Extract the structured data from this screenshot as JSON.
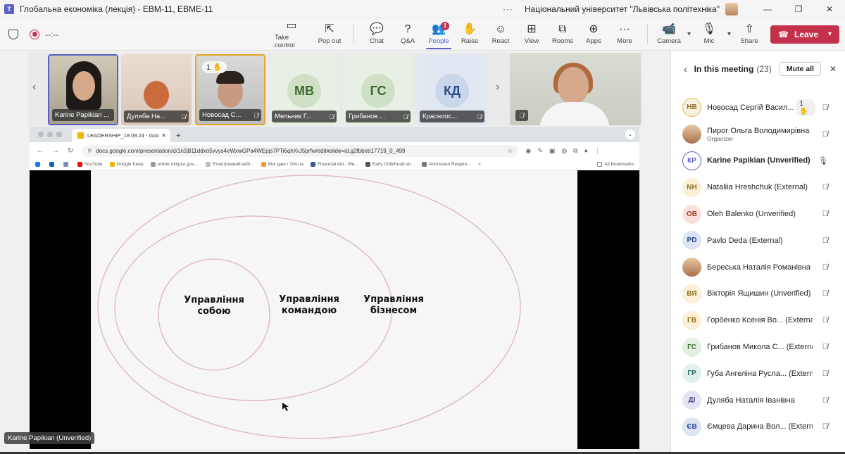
{
  "window": {
    "title": "Глобальна економіка (лекція) - ЕВМ-11, ЕВМЕ-11",
    "org": "Національний університет \"Львівська політехніка\"",
    "more": "···",
    "min": "—",
    "max": "❐",
    "close": "✕"
  },
  "toolbar": {
    "timer": "--:--",
    "buttons": [
      {
        "label": "Take control",
        "icon": "▭"
      },
      {
        "label": "Pop out",
        "icon": "⇱"
      },
      {
        "label": "Chat",
        "icon": "💬"
      },
      {
        "label": "Q&A",
        "icon": "?"
      },
      {
        "label": "People",
        "icon": "👥",
        "badge": "1"
      },
      {
        "label": "Raise",
        "icon": "✋"
      },
      {
        "label": "React",
        "icon": "☺"
      },
      {
        "label": "View",
        "icon": "⊞"
      },
      {
        "label": "Rooms",
        "icon": "⧉"
      },
      {
        "label": "Apps",
        "icon": "⊕"
      },
      {
        "label": "More",
        "icon": "···"
      },
      {
        "label": "Camera",
        "icon": "📹"
      },
      {
        "label": "Mic",
        "icon": "🎙"
      },
      {
        "label": "Share",
        "icon": "⇧"
      }
    ],
    "leave_label": "Leave"
  },
  "strip": {
    "tiles": [
      {
        "name": "Karine Papikian ...",
        "initials": ""
      },
      {
        "name": "Дуляба На...",
        "initials": ""
      },
      {
        "name": "Новосад С...",
        "initials": "",
        "hand": "1 ✋"
      },
      {
        "name": "Мельник Г...",
        "initials": "МВ"
      },
      {
        "name": "Грибанов ...",
        "initials": "ГС"
      },
      {
        "name": "Красноос...",
        "initials": "КД"
      }
    ]
  },
  "browser": {
    "tab_title": "LEADERSHIP_18.09.24 - Goo",
    "url": "docs.google.com/presentation/d/1nSB11ddxo5vvys4eWxwGPa4WEpjs7PTi6qhXrJ5prfw/edit#slide=id.g2fbbeb17719_0_499",
    "bookmarks": [
      "YouTube",
      "Google Keep",
      "online.minjust.gov....",
      "Електронний кабі...",
      "Мої дані / 104.ua",
      "Financial Aid - We...",
      "Early Childhood an...",
      "Admission Require..."
    ],
    "all_bookmarks": "All Bookmarks"
  },
  "slide": {
    "inner": "Управління собою",
    "middle": "Управління командою",
    "outer": "Управління бізнесом"
  },
  "speaker_tag": "Karine Papikian (Unverified)",
  "panel": {
    "title": "In this meeting",
    "count": "(23)",
    "mute_all": "Mute all",
    "participants": [
      {
        "initials": "НВ",
        "name": "Новосад Сергій Васил...",
        "hand": "1 ✋",
        "color": "#f7f0e0",
        "fg": "#8a6d1c",
        "ring": "#e6b84a"
      },
      {
        "initials": "",
        "name": "Пирог Ольга Володимирівна",
        "sub": "Organizer",
        "photo": true
      },
      {
        "initials": "КР",
        "name": "Karine Papikian (Unverified)",
        "color": "#fff",
        "fg": "#5b5fc7",
        "ring": "#5b5fc7",
        "bold": true,
        "unmuted": true
      },
      {
        "initials": "NH",
        "name": "Nataliia Hreshchuk (External)",
        "color": "#fcefd6",
        "fg": "#8a6d1c"
      },
      {
        "initials": "OB",
        "name": "Oleh Balenko (Unverified)",
        "color": "#f8e1dc",
        "fg": "#a33a24"
      },
      {
        "initials": "PD",
        "name": "Pavlo Deda (External)",
        "color": "#dde5f5",
        "fg": "#2b4a8a"
      },
      {
        "initials": "",
        "name": "Береська Наталія Романівна",
        "photo": true
      },
      {
        "initials": "ВЯ",
        "name": "Вікторія Ящишин (Unverified)",
        "color": "#fcefd6",
        "fg": "#8a6d1c"
      },
      {
        "initials": "ГВ",
        "name": "Горбенко Ксенія Во... (External)",
        "color": "#fcefd6",
        "fg": "#8a6d1c"
      },
      {
        "initials": "ГС",
        "name": "Грибанов Микола С... (External)",
        "color": "#e3efdf",
        "fg": "#3d6b2e"
      },
      {
        "initials": "ГР",
        "name": "Губа Ангеліна Русла... (External)",
        "color": "#dff0ee",
        "fg": "#2f6d66"
      },
      {
        "initials": "ДІ",
        "name": "Дуляба Наталія Іванівна",
        "color": "#e4e4f2",
        "fg": "#4b4b8a"
      },
      {
        "initials": "ЄВ",
        "name": "Ємцева Дарина Вол... (External)",
        "color": "#dde5f5",
        "fg": "#2b4a8a"
      }
    ]
  }
}
